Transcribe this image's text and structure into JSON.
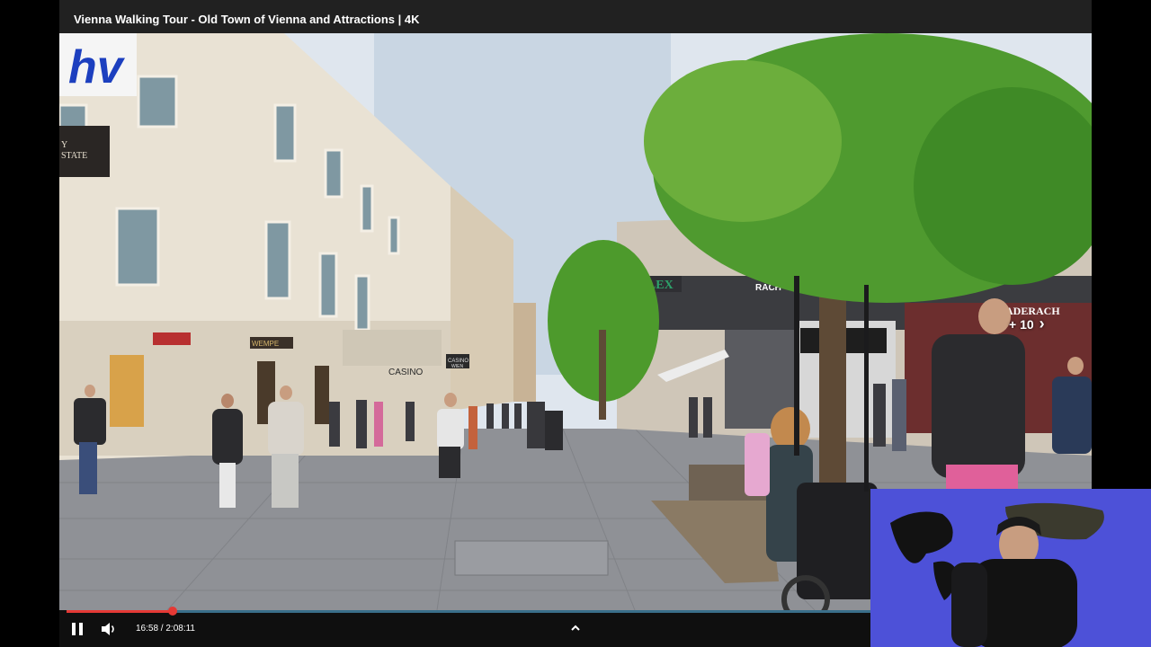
{
  "video": {
    "title": "Vienna Walking Tour - Old Town of Vienna and Attractions | 4K",
    "current_time": "16:58",
    "duration": "2:08:11",
    "time_separator": " / ",
    "progress_fraction": 0.1323
  },
  "seek_overlay": {
    "label": "+ 10",
    "icon": "chevron-right-icon"
  },
  "controls": {
    "pause_icon": "pause-icon",
    "volume_icon": "volume-icon",
    "expand_icon": "chevron-up-icon"
  },
  "scene_signs": {
    "hv_logo": "hv",
    "estate_sign": "Y\nSTATE",
    "rolex": "OLEX",
    "rach": "RACH",
    "laderach": "LADERACH",
    "casino_1": "CASINO",
    "casino_2": "CASINO\nWIEN",
    "wempe": "WEMPE"
  },
  "colors": {
    "title_bar": "#212121",
    "control_bar": "#0f0f0f",
    "progress_fill": "#e53935",
    "progress_track": "#3a6f8a",
    "webcam_bg": "#4d51d8"
  }
}
